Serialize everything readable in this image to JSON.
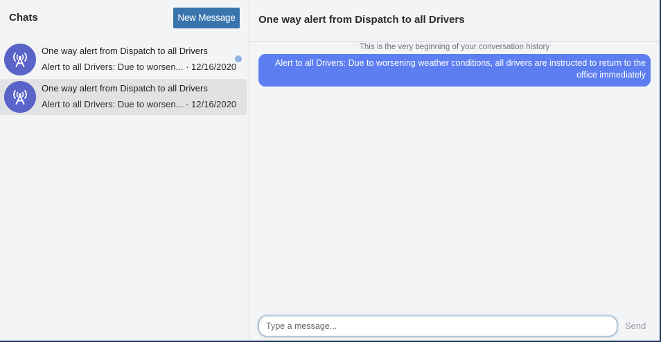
{
  "sidebar": {
    "title": "Chats",
    "new_message_label": "New Message",
    "chats": [
      {
        "avatar_icon": "radio-tower-icon",
        "title": "One way alert from Dispatch to all Drivers",
        "preview": "Alert to all Drivers: Due to worsen...",
        "date": "12/16/2020",
        "unread": true
      },
      {
        "avatar_icon": "radio-tower-icon",
        "title": "One way alert from Dispatch to all Drivers",
        "preview": "Alert to all Drivers: Due to worsen...",
        "date": "12/16/2020",
        "selected": true
      }
    ]
  },
  "conversation": {
    "title": "One way alert from Dispatch to all Drivers",
    "history_note": "This is the very beginning of your conversation history",
    "messages": [
      {
        "text": "Alert to all Drivers: Due to worsening weather conditions, all drivers are instructed to return to the office immediately"
      }
    ],
    "input_placeholder": "Type a message...",
    "send_label": "Send"
  },
  "colors": {
    "accent": "#3a74ad",
    "bubble": "#5c7ef0",
    "avatar": "#5a63c7",
    "unread_dot": "#8fb4e3"
  }
}
